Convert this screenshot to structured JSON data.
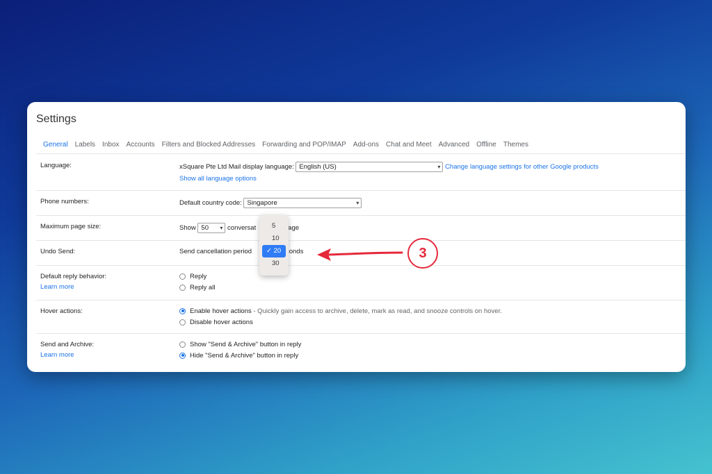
{
  "settings": {
    "title": "Settings",
    "tabs": [
      "General",
      "Labels",
      "Inbox",
      "Accounts",
      "Filters and Blocked Addresses",
      "Forwarding and POP/IMAP",
      "Add-ons",
      "Chat and Meet",
      "Advanced",
      "Offline",
      "Themes"
    ],
    "language": {
      "label": "Language:",
      "prefix": "xSquare Pte Ltd Mail display language:",
      "value": "English (US)",
      "change_link": "Change language settings for other Google products",
      "show_all": "Show all language options"
    },
    "phone": {
      "label": "Phone numbers:",
      "prefix": "Default country code:",
      "value": "Singapore"
    },
    "page_size": {
      "label": "Maximum page size:",
      "show": "Show",
      "value": "50",
      "suffix_a": "conversat",
      "suffix_b": "page"
    },
    "undo_send": {
      "label": "Undo Send:",
      "prefix": "Send cancellation period",
      "suffix": "econds",
      "options": [
        "5",
        "10",
        "20",
        "30"
      ],
      "selected": "20",
      "check": "✓"
    },
    "reply": {
      "label": "Default reply behavior:",
      "learn_more": "Learn more",
      "options": [
        "Reply",
        "Reply all"
      ]
    },
    "hover": {
      "label": "Hover actions:",
      "enable": "Enable hover actions",
      "enable_desc": " - Quickly gain access to archive, delete, mark as read, and snooze controls on hover.",
      "disable": "Disable hover actions"
    },
    "send_archive": {
      "label": "Send and Archive:",
      "learn_more": "Learn more",
      "show": "Show \"Send & Archive\" button in reply",
      "hide": "Hide \"Send & Archive\" button in reply"
    }
  },
  "annotation": {
    "number": "3",
    "color": "#e5283a"
  },
  "colors": {
    "accent": "#1a73e8",
    "dropdown_selected": "#2f7cf6"
  }
}
